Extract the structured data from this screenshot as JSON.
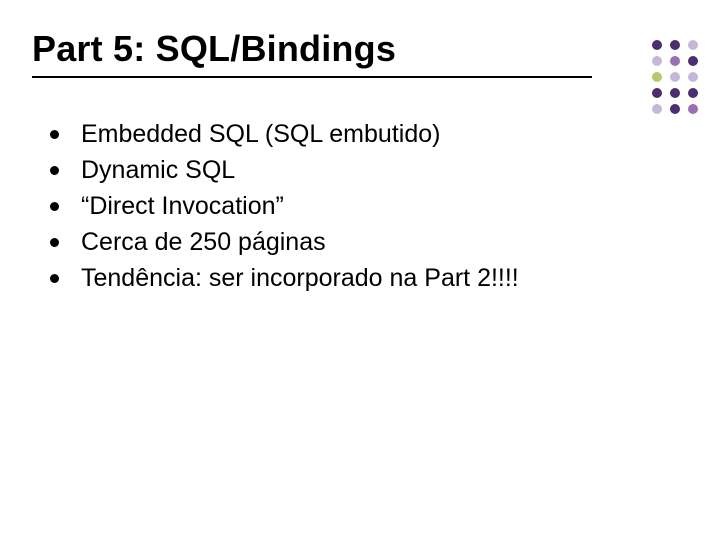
{
  "title": "Part 5: SQL/Bindings",
  "bullets": [
    "Embedded SQL (SQL embutido)",
    "Dynamic SQL",
    "“Direct Invocation”",
    "Cerca de 250 páginas",
    "Tendência: ser incorporado na Part 2!!!!"
  ],
  "decor_colors": [
    [
      "#4A2E6F",
      "#4A2E6F",
      "#C6B8DB"
    ],
    [
      "#C6B8DB",
      "#9A6FB0",
      "#4A2E6F"
    ],
    [
      "#B7C96A",
      "#C6B8DB",
      "#C6B8DB"
    ],
    [
      "#4A2E6F",
      "#4A2E6F",
      "#4A2E6F"
    ],
    [
      "#C6B8DB",
      "#4A2E6F",
      "#9A6FB0"
    ]
  ]
}
